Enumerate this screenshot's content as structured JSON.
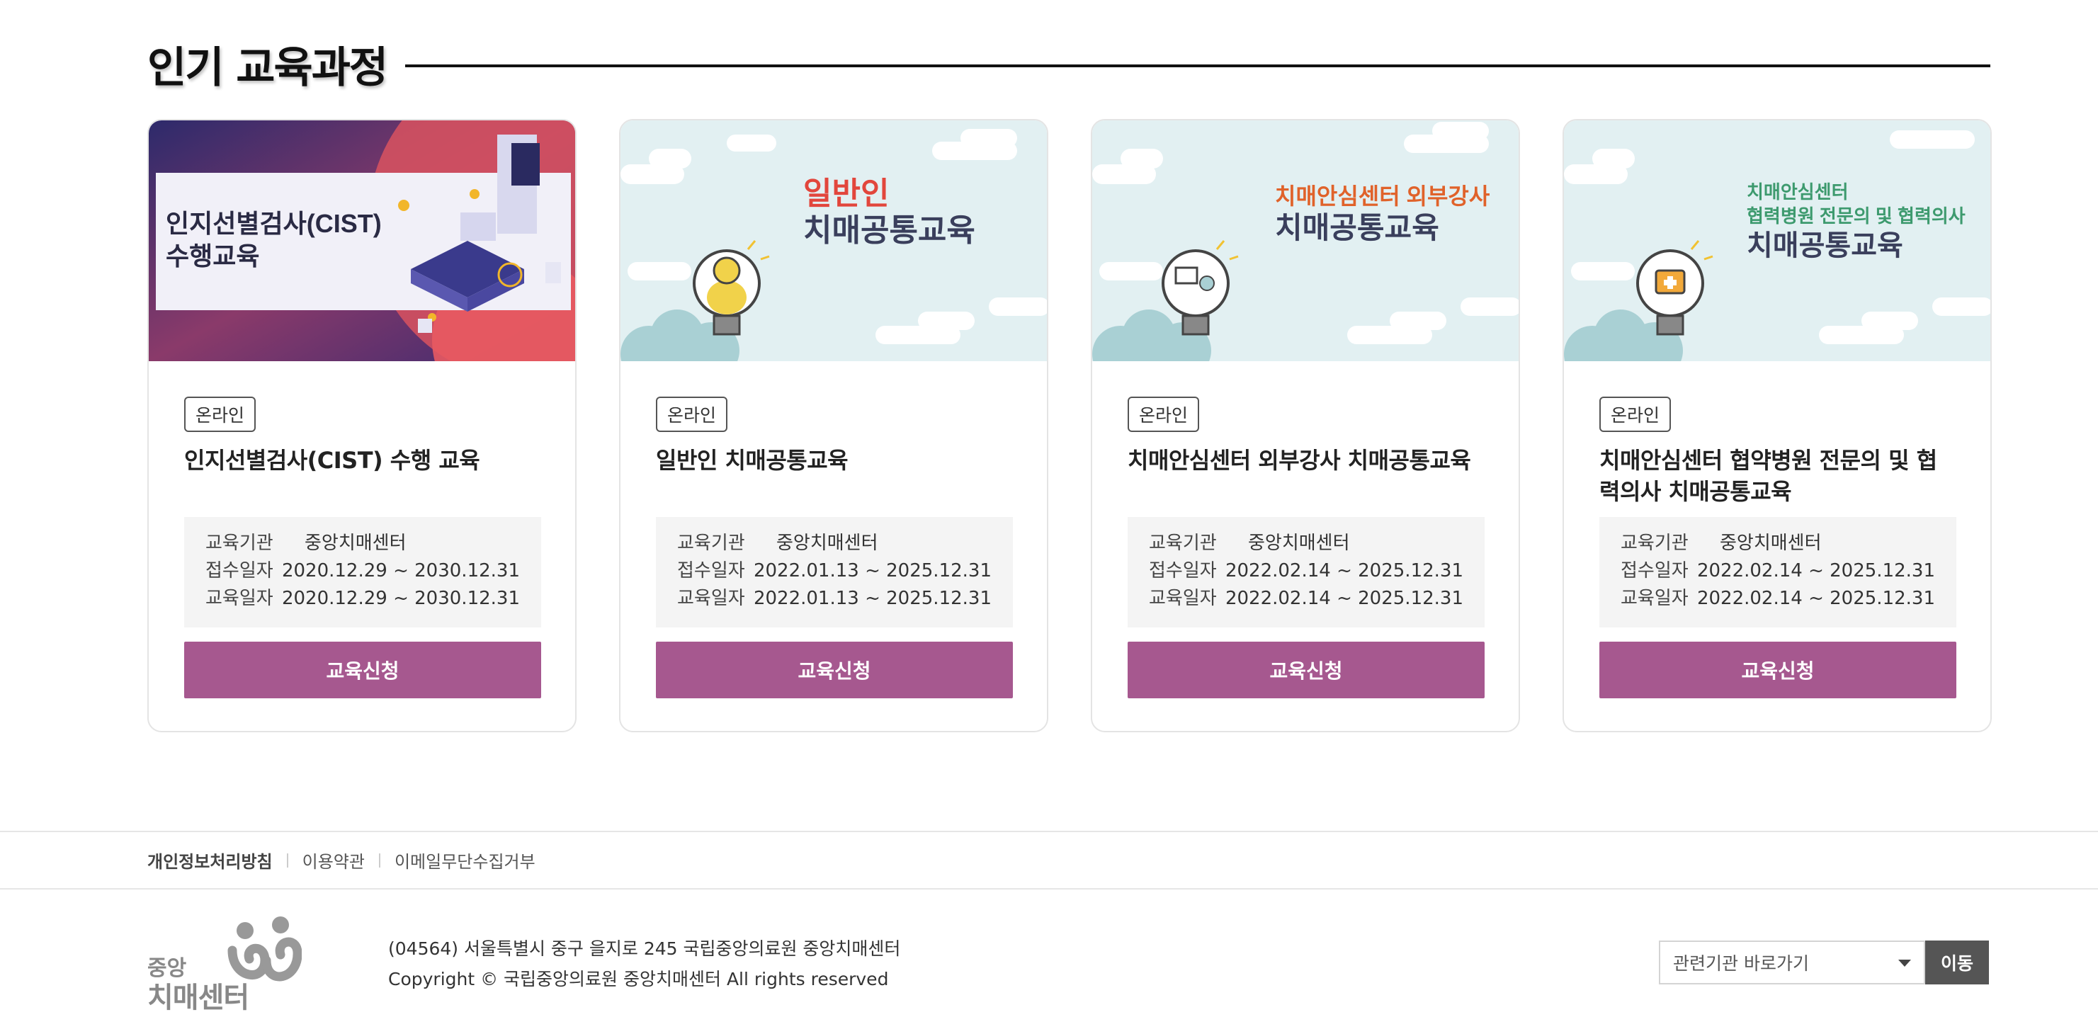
{
  "section": {
    "title": "인기 교육과정"
  },
  "courses": [
    {
      "thumb_lines": [
        "인지선별검사(CIST)",
        "수행교육"
      ],
      "badge": "온라인",
      "title": "인지선별검사(CIST) 수행 교육",
      "info": [
        {
          "label": "교육기관",
          "value": "중앙치매센터"
        },
        {
          "label": "접수일자",
          "value": "2020.12.29 ~ 2030.12.31"
        },
        {
          "label": "교육일자",
          "value": "2020.12.29 ~ 2030.12.31"
        }
      ],
      "apply_label": "교육신청"
    },
    {
      "thumb_lines": [
        "일반인",
        "치매공통교육"
      ],
      "badge": "온라인",
      "title": "일반인 치매공통교육",
      "info": [
        {
          "label": "교육기관",
          "value": "중앙치매센터"
        },
        {
          "label": "접수일자",
          "value": "2022.01.13 ~ 2025.12.31"
        },
        {
          "label": "교육일자",
          "value": "2022.01.13 ~ 2025.12.31"
        }
      ],
      "apply_label": "교육신청"
    },
    {
      "thumb_lines": [
        "치매안심센터 외부강사",
        "치매공통교육"
      ],
      "badge": "온라인",
      "title": "치매안심센터 외부강사 치매공통교육",
      "info": [
        {
          "label": "교육기관",
          "value": "중앙치매센터"
        },
        {
          "label": "접수일자",
          "value": "2022.02.14 ~ 2025.12.31"
        },
        {
          "label": "교육일자",
          "value": "2022.02.14 ~ 2025.12.31"
        }
      ],
      "apply_label": "교육신청"
    },
    {
      "thumb_lines": [
        "치매안심센터",
        "협력병원 전문의 및 협력의사",
        "치매공통교육"
      ],
      "badge": "온라인",
      "title": "치매안심센터 협약병원 전문의 및 협력의사 치매공통교육",
      "info": [
        {
          "label": "교육기관",
          "value": "중앙치매센터"
        },
        {
          "label": "접수일자",
          "value": "2022.02.14 ~ 2025.12.31"
        },
        {
          "label": "교육일자",
          "value": "2022.02.14 ~ 2025.12.31"
        }
      ],
      "apply_label": "교육신청"
    }
  ],
  "footer": {
    "links": [
      "개인정보처리방침",
      "이용약관",
      "이메일무단수집거부"
    ],
    "logo_small": "중앙",
    "logo_big": "치매센터",
    "address": "(04564) 서울특별시 중구 을지로 245 국립중앙의료원 중앙치매센터",
    "copyright": "Copyright © 국립중앙의료원 중앙치매센터 All rights reserved",
    "related_select": "관련기관 바로가기",
    "go_label": "이동"
  },
  "colors": {
    "accent": "#a6588f",
    "thumb_bg": "#e2f0f2",
    "red_text": "#e2463c",
    "orange_text": "#e0622a",
    "green_text": "#3d9a6e",
    "navy_text": "#3a3f5c"
  }
}
